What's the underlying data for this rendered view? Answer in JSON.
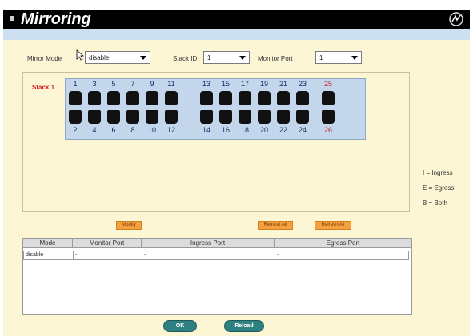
{
  "header": {
    "title": "Mirroring"
  },
  "controls": {
    "mirror_mode_label": "Mirror Mode",
    "mirror_mode_value": "disable",
    "stack_id_label": "Stack ID:",
    "stack_id_value": "1",
    "monitor_port_label": "Monitor Port",
    "monitor_port_value": "1"
  },
  "stack": {
    "label": "Stack 1",
    "top_ports": [
      "1",
      "3",
      "5",
      "7",
      "9",
      "11",
      "13",
      "15",
      "17",
      "19",
      "21",
      "23",
      "25"
    ],
    "bottom_ports": [
      "2",
      "4",
      "6",
      "8",
      "10",
      "12",
      "14",
      "16",
      "18",
      "20",
      "22",
      "24",
      "26"
    ]
  },
  "legend": {
    "ingress": "I = Ingress",
    "egress": "E = Egress",
    "both": "B = Both"
  },
  "actions": {
    "modify": "Modify",
    "refresh": "Refresh All",
    "refresh_all": "Refresh All"
  },
  "table": {
    "headers": [
      "Mode",
      "Monitor Port",
      "Ingress Port",
      "Egress Port"
    ],
    "row": [
      "disable",
      "-",
      "-",
      "-"
    ]
  },
  "footer": {
    "ok": "OK",
    "reload": "Reload"
  }
}
